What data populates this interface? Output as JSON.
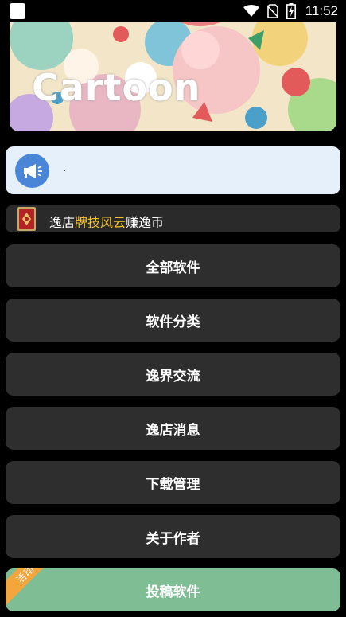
{
  "status_bar": {
    "time": "11:52"
  },
  "banner": {
    "text": "Cartoon"
  },
  "notice": {
    "text": "."
  },
  "ad": {
    "prefix": "逸店",
    "highlight": "牌技风云",
    "suffix": "赚逸币"
  },
  "menu": [
    {
      "label": "全部软件"
    },
    {
      "label": "软件分类"
    },
    {
      "label": "逸界交流"
    },
    {
      "label": "逸店消息"
    },
    {
      "label": "下载管理"
    },
    {
      "label": "关于作者"
    }
  ],
  "submit": {
    "label": "投稿软件",
    "ribbon": "活动"
  },
  "colors": {
    "accent_green": "#7fbd95",
    "highlight_yellow": "#f7c226",
    "notice_bg": "#e5f0fb",
    "ribbon_orange": "#f4a53c"
  }
}
